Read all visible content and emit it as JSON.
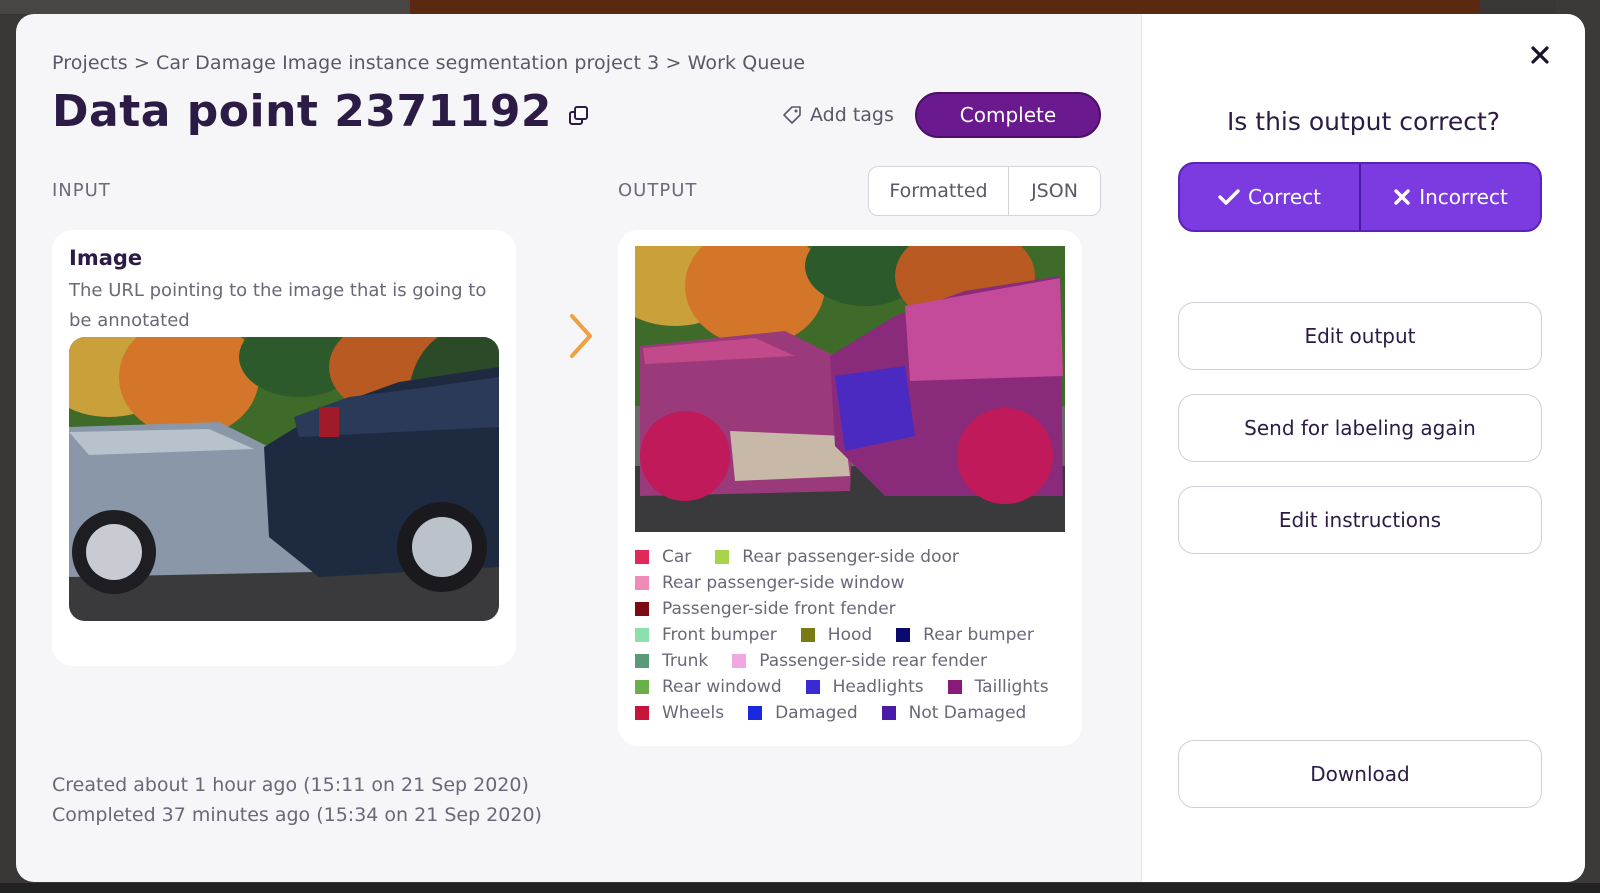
{
  "breadcrumb": "Projects > Car Damage Image instance segmentation project 3 > Work Queue",
  "title": "Data point 2371192",
  "header": {
    "add_tags_label": "Add tags",
    "complete_label": "Complete"
  },
  "input": {
    "section_label": "INPUT",
    "image_title": "Image",
    "image_description": "The URL pointing to the image that is going to be annotated"
  },
  "output": {
    "section_label": "OUTPUT",
    "tabs": {
      "formatted": "Formatted",
      "json": "JSON"
    },
    "legend": [
      [
        {
          "label": "Car",
          "color": "#e0285a"
        },
        {
          "label": "Rear passenger-side door",
          "color": "#a8d44a"
        }
      ],
      [
        {
          "label": "Rear passenger-side window",
          "color": "#f08ab8"
        }
      ],
      [
        {
          "label": "Passenger-side front fender",
          "color": "#7a0a14"
        }
      ],
      [
        {
          "label": "Front bumper",
          "color": "#8ce0ac"
        },
        {
          "label": "Hood",
          "color": "#7a7a14"
        },
        {
          "label": "Rear bumper",
          "color": "#0a0a6e"
        }
      ],
      [
        {
          "label": "Trunk",
          "color": "#5a9a78"
        },
        {
          "label": "Passenger-side rear fender",
          "color": "#f0a8e0"
        }
      ],
      [
        {
          "label": "Rear windowd",
          "color": "#6ab04a"
        },
        {
          "label": "Headlights",
          "color": "#3a2ad4"
        },
        {
          "label": "Taillights",
          "color": "#8a1a7a"
        }
      ],
      [
        {
          "label": "Wheels",
          "color": "#c8143a"
        },
        {
          "label": "Damaged",
          "color": "#1a28e0"
        },
        {
          "label": "Not Damaged",
          "color": "#4a1aa8"
        }
      ]
    ]
  },
  "meta": {
    "created": "Created about 1 hour ago (15:11 on 21 Sep 2020)",
    "completed": "Completed 37 minutes ago (15:34 on 21 Sep 2020)"
  },
  "side": {
    "question": "Is this output correct?",
    "correct_label": "Correct",
    "incorrect_label": "Incorrect",
    "edit_output": "Edit output",
    "send_labeling": "Send for labeling again",
    "edit_instructions": "Edit instructions",
    "download": "Download"
  },
  "colors": {
    "brand_purple": "#6a1a8e",
    "judge_purple": "#7b3be0",
    "arrow_orange": "#f0a040"
  }
}
